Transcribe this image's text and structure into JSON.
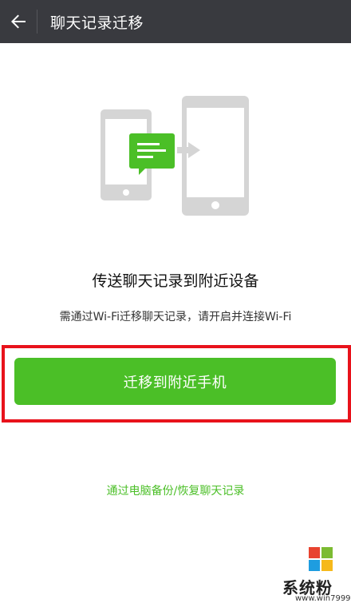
{
  "header": {
    "back_icon": "arrow-left-icon",
    "title": "聊天记录迁移"
  },
  "illustration": {
    "description_icons": [
      "phone-icon",
      "chat-bubble-icon",
      "arrow-right-icon",
      "phone-icon"
    ]
  },
  "main": {
    "headline": "传送聊天记录到附近设备",
    "subtext": "需通过Wi-Fi迁移聊天记录，请开启并连接Wi-Fi",
    "primary_button_label": "迁移到附近手机",
    "backup_link_label": "通过电脑备份/恢复聊天记录"
  },
  "watermark": {
    "name": "系统粉",
    "url": "www.win7999.com"
  },
  "colors": {
    "appbar_bg": "#393a3f",
    "accent_green": "#4bbf27",
    "highlight_red": "#e8121b",
    "device_gray": "#d5d5d5"
  }
}
